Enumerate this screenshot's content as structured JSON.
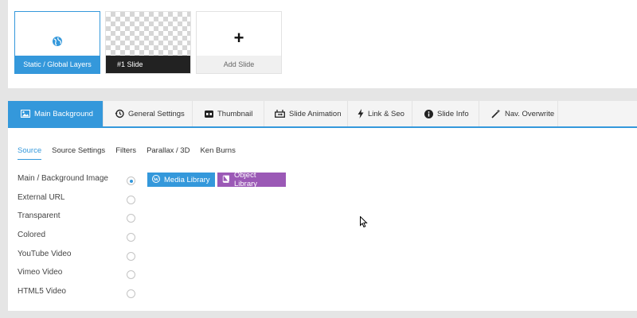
{
  "slides": [
    {
      "caption": "Static / Global Layers",
      "icon": "globe-icon"
    },
    {
      "caption": "#1 Slide"
    },
    {
      "caption": "Add Slide",
      "icon": "plus-icon"
    }
  ],
  "tabs": [
    {
      "label": "Main Background",
      "icon": "image-icon",
      "active": true
    },
    {
      "label": "General Settings",
      "icon": "history-icon"
    },
    {
      "label": "Thumbnail",
      "icon": "thumbnail-icon"
    },
    {
      "label": "Slide Animation",
      "icon": "animation-icon"
    },
    {
      "label": "Link & Seo",
      "icon": "bolt-icon"
    },
    {
      "label": "Slide Info",
      "icon": "info-icon"
    },
    {
      "label": "Nav. Overwrite",
      "icon": "magic-wand-icon"
    }
  ],
  "subtabs": [
    "Source",
    "Source Settings",
    "Filters",
    "Parallax / 3D",
    "Ken Burns"
  ],
  "source_options": [
    {
      "label": "Main / Background Image",
      "checked": true
    },
    {
      "label": "External URL"
    },
    {
      "label": "Transparent"
    },
    {
      "label": "Colored"
    },
    {
      "label": "YouTube Video"
    },
    {
      "label": "Vimeo Video"
    },
    {
      "label": "HTML5 Video"
    }
  ],
  "buttons": {
    "media_library": "Media Library",
    "object_library": "Object Library"
  },
  "colors": {
    "accent": "#3498db",
    "object_library": "#9b59b6",
    "slide_caption_bg": "#222222"
  }
}
